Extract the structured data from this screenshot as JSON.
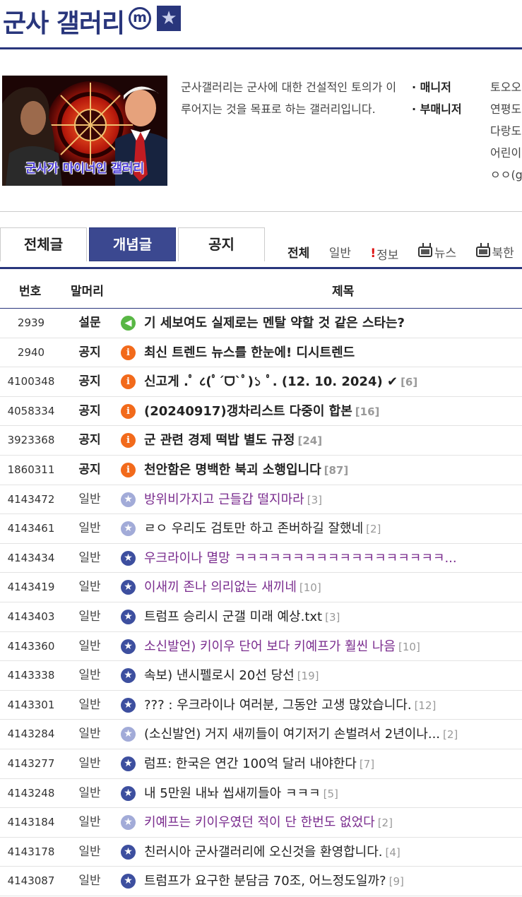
{
  "header": {
    "title": "군사 갤러리",
    "minor_badge": "m",
    "star_badge": "★"
  },
  "info": {
    "thumbnail_caption": "군사가 마이너인 갤러리",
    "description": "군사갤러리는 군사에 대한 건설적인 토의가 이루어지는 것을 목표로 하는 갤러리입니다.",
    "manager_label": "매니저",
    "submanager_label": "부매니저",
    "manager_names": [
      "토오오",
      "연평도",
      "다랑도",
      "어린이",
      "ㅇㅇ(g"
    ]
  },
  "tabs": [
    {
      "label": "전체글"
    },
    {
      "label": "개념글"
    },
    {
      "label": "공지"
    }
  ],
  "categories": [
    {
      "label": "전체",
      "icon": ""
    },
    {
      "label": "일반",
      "icon": ""
    },
    {
      "label": "정보",
      "icon": "exclamation-icon"
    },
    {
      "label": "뉴스",
      "icon": "tv-icon"
    },
    {
      "label": "북한",
      "icon": "tv-icon"
    }
  ],
  "table": {
    "col_number": "번호",
    "col_head": "말머리",
    "col_title": "제목"
  },
  "colors": {
    "brand": "#29367c",
    "active_tab": "#3b4890",
    "visited": "#7a2c8e",
    "notice_icon": "#f26a1b",
    "survey_icon": "#58b744",
    "star_icon": "#3d4f9f"
  },
  "rows": [
    {
      "num": "2939",
      "head": "설문",
      "icon": "speaker-icon",
      "title": "기 세보여도 실제로는 멘탈 약할 것 같은 스타는?",
      "reply": "",
      "type": "notice",
      "visited": false
    },
    {
      "num": "2940",
      "head": "공지",
      "icon": "info-icon",
      "title": "최신 트렌드 뉴스를 한눈에! 디시트렌드",
      "reply": "",
      "type": "notice",
      "visited": false
    },
    {
      "num": "4100348",
      "head": "공지",
      "icon": "info-icon",
      "title": "신고게 .ﾟ ८(ﾟ´ᗜ`ﾟ)১ ﾟ. (12. 10. 2024) ✔",
      "reply": "[6]",
      "type": "notice",
      "visited": false
    },
    {
      "num": "4058334",
      "head": "공지",
      "icon": "info-icon",
      "title": "(20240917)갱차리스트 다중이 합본",
      "reply": "[16]",
      "type": "notice",
      "visited": false
    },
    {
      "num": "3923368",
      "head": "공지",
      "icon": "info-icon",
      "title": "군 관련 경제 떡밥 별도 규정",
      "reply": "[24]",
      "type": "notice",
      "visited": false
    },
    {
      "num": "1860311",
      "head": "공지",
      "icon": "info-icon",
      "title": "천안함은 명백한 북괴 소행입니다",
      "reply": "[87]",
      "type": "notice",
      "visited": false
    },
    {
      "num": "4143472",
      "head": "일반",
      "icon": "star-light-icon",
      "title": "방위비가지고 근들갑 떨지마라",
      "reply": "[3]",
      "type": "normal",
      "visited": true
    },
    {
      "num": "4143461",
      "head": "일반",
      "icon": "star-light-icon",
      "title": "ㄹㅇ 우리도 검토만 하고 존버하길 잘했네",
      "reply": "[2]",
      "type": "normal",
      "visited": false
    },
    {
      "num": "4143434",
      "head": "일반",
      "icon": "star-icon",
      "title": "우크라이나 멸망 ㅋㅋㅋㅋㅋㅋㅋㅋㅋㅋㅋㅋㅋㅋㅋㅋㅋㅋ...",
      "reply": "",
      "type": "normal",
      "visited": true
    },
    {
      "num": "4143419",
      "head": "일반",
      "icon": "star-icon",
      "title": "이새끼 존나 의리없는 새끼네",
      "reply": "[10]",
      "type": "normal",
      "visited": true
    },
    {
      "num": "4143403",
      "head": "일반",
      "icon": "star-icon",
      "title": "트럼프 승리시 군갤 미래 예상.txt",
      "reply": "[3]",
      "type": "normal",
      "visited": false
    },
    {
      "num": "4143360",
      "head": "일반",
      "icon": "star-icon",
      "title": "소신발언) 키이우 단어 보다 키예프가 훨씬 나음",
      "reply": "[10]",
      "type": "normal",
      "visited": true
    },
    {
      "num": "4143338",
      "head": "일반",
      "icon": "star-icon",
      "title": "속보) 낸시펠로시 20선 당선",
      "reply": "[19]",
      "type": "normal",
      "visited": false
    },
    {
      "num": "4143301",
      "head": "일반",
      "icon": "star-icon",
      "title": "??? : 우크라이나 여러분, 그동안 고생 많았습니다.",
      "reply": "[12]",
      "type": "normal",
      "visited": false
    },
    {
      "num": "4143284",
      "head": "일반",
      "icon": "star-light-icon",
      "title": "(소신발언) 거지 새끼들이 여기저기 손벌려서 2년이나...",
      "reply": "[2]",
      "type": "normal",
      "visited": false
    },
    {
      "num": "4143277",
      "head": "일반",
      "icon": "star-icon",
      "title": "럼프: 한국은 연간 100억 달러 내야한다",
      "reply": "[7]",
      "type": "normal",
      "visited": false
    },
    {
      "num": "4143248",
      "head": "일반",
      "icon": "star-icon",
      "title": "내 5만원 내놔 씹새끼들아 ㅋㅋㅋ",
      "reply": "[5]",
      "type": "normal",
      "visited": false
    },
    {
      "num": "4143184",
      "head": "일반",
      "icon": "star-light-icon",
      "title": "키예프는 키이우였던 적이 단 한번도 없었다",
      "reply": "[2]",
      "type": "normal",
      "visited": true
    },
    {
      "num": "4143178",
      "head": "일반",
      "icon": "star-icon",
      "title": "친러시아 군사갤러리에 오신것을 환영합니다.",
      "reply": "[4]",
      "type": "normal",
      "visited": false
    },
    {
      "num": "4143087",
      "head": "일반",
      "icon": "star-icon",
      "title": "트럼프가 요구한 분담금 70조, 어느정도일까?",
      "reply": "[9]",
      "type": "normal",
      "visited": false
    }
  ]
}
